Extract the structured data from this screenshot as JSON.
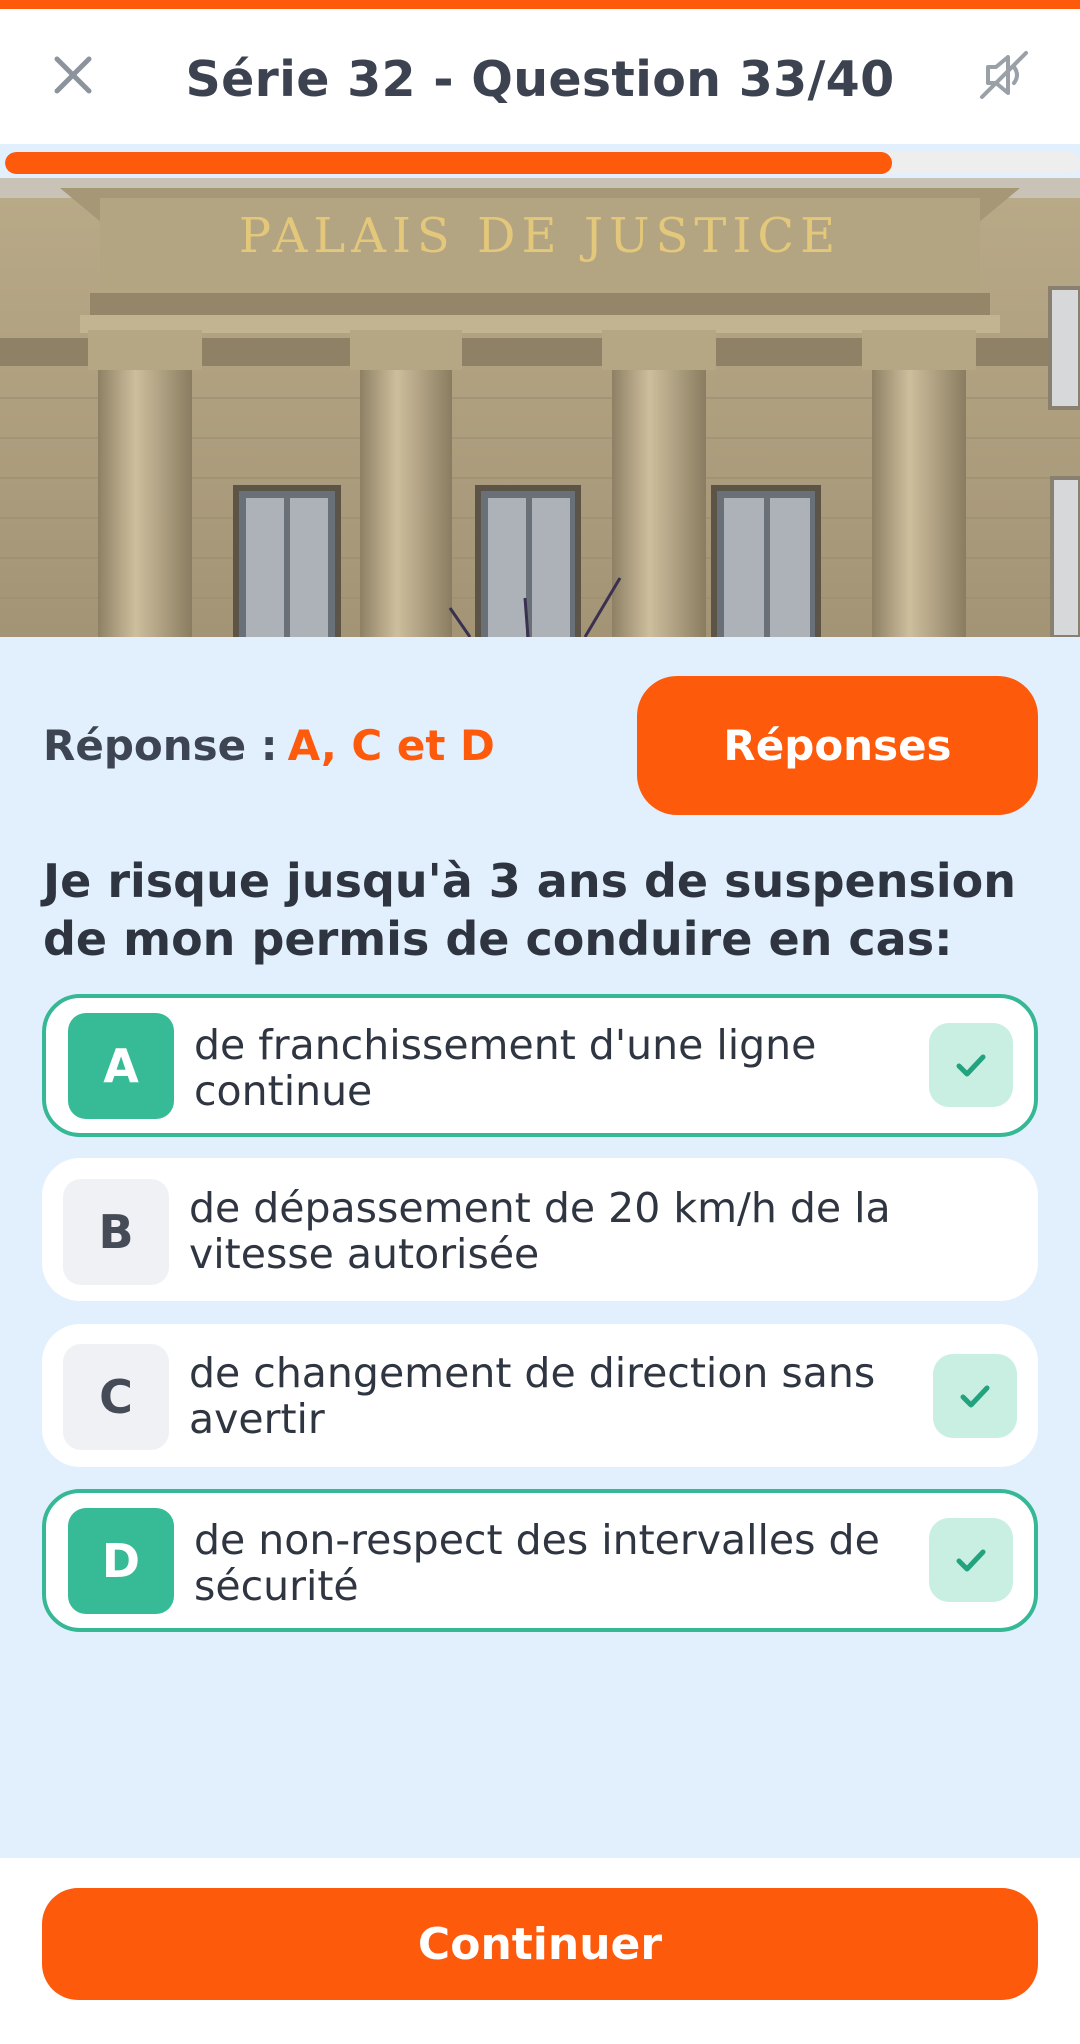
{
  "header": {
    "title": "Série 32 - Question 33/40",
    "close_icon": "close-icon",
    "sound_icon": "sound-off-icon"
  },
  "progress": {
    "fraction": 0.825
  },
  "photo": {
    "inscription": "PALAIS DE JUSTICE"
  },
  "answer": {
    "label": "Réponse :",
    "value": "A, C et D"
  },
  "reponses_button": "Réponses",
  "question": "Je risque jusqu'à 3 ans de suspension de mon permis de conduire en cas:",
  "options": [
    {
      "letter": "A",
      "text": "de franchissement d'une ligne continue",
      "selected": true,
      "correct": true
    },
    {
      "letter": "B",
      "text": "de dépassement de 20 km/h de la vitesse autorisée",
      "selected": false,
      "correct": false
    },
    {
      "letter": "C",
      "text": "de changement de direction sans avertir",
      "selected": false,
      "correct": true
    },
    {
      "letter": "D",
      "text": "de non-respect des intervalles de sécurité",
      "selected": true,
      "correct": true
    }
  ],
  "continue_button": "Continuer",
  "colors": {
    "accent": "#fd5a0c",
    "correct": "#36bb96",
    "background": "#e2f0fd"
  }
}
